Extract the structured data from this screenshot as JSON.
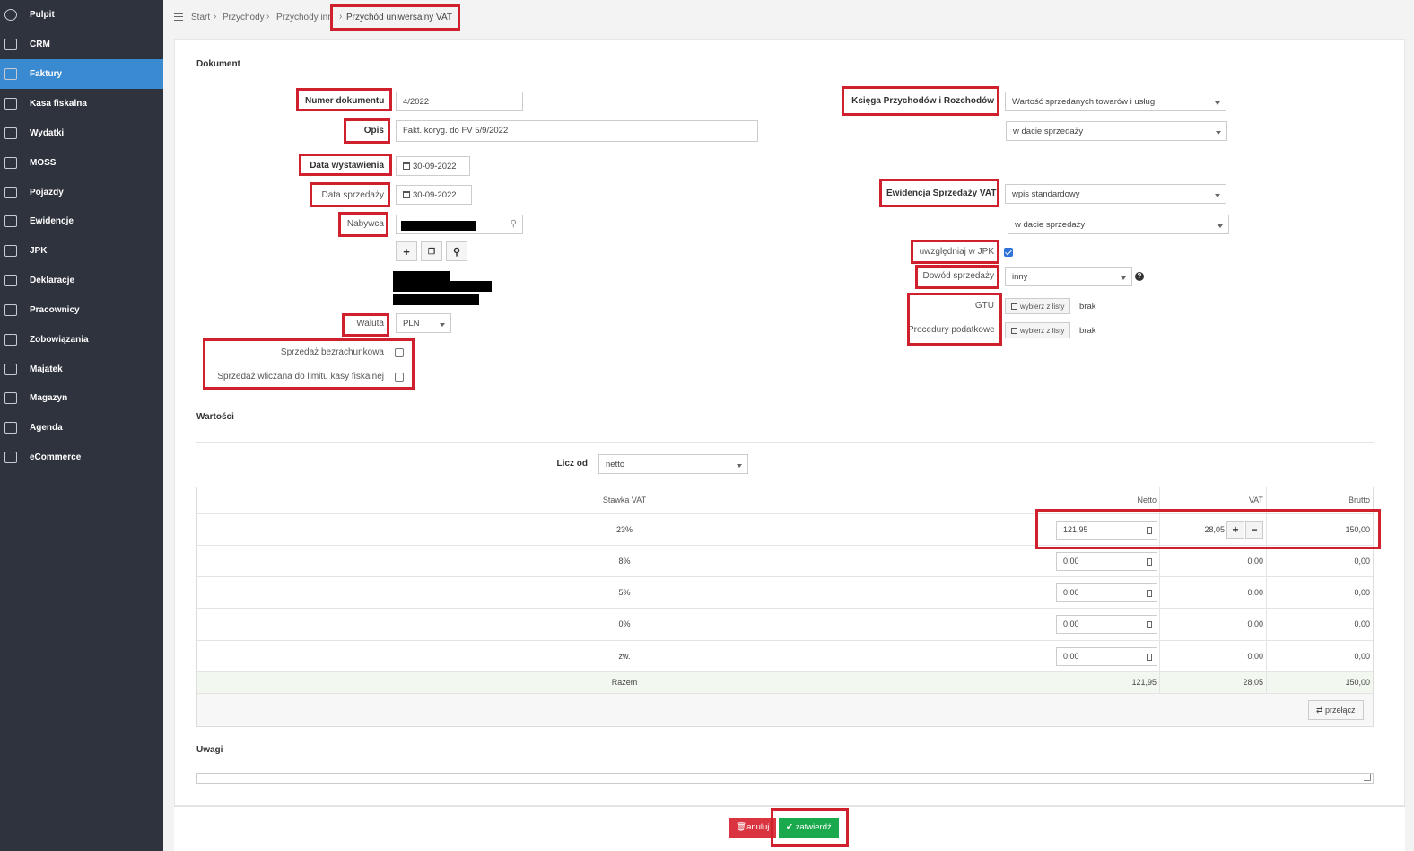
{
  "sidebar": {
    "items": [
      {
        "label": "Pulpit",
        "icon": "dashboard-icon"
      },
      {
        "label": "CRM",
        "icon": "crm-icon"
      },
      {
        "label": "Faktury",
        "icon": "invoice-icon",
        "active": true
      },
      {
        "label": "Kasa fiskalna",
        "icon": "cash-register-icon"
      },
      {
        "label": "Wydatki",
        "icon": "expenses-icon"
      },
      {
        "label": "MOSS",
        "icon": "moss-icon"
      },
      {
        "label": "Pojazdy",
        "icon": "car-icon"
      },
      {
        "label": "Ewidencje",
        "icon": "records-icon"
      },
      {
        "label": "JPK",
        "icon": "jpk-icon"
      },
      {
        "label": "Deklaracje",
        "icon": "declarations-icon"
      },
      {
        "label": "Pracownicy",
        "icon": "employees-icon"
      },
      {
        "label": "Zobowiązania",
        "icon": "liabilities-icon"
      },
      {
        "label": "Majątek",
        "icon": "assets-icon"
      },
      {
        "label": "Magazyn",
        "icon": "warehouse-icon"
      },
      {
        "label": "Agenda",
        "icon": "agenda-icon"
      },
      {
        "label": "eCommerce",
        "icon": "cart-icon"
      }
    ]
  },
  "breadcrumb": {
    "items": [
      "Start",
      "Przychody",
      "Przychody inn",
      "Przychód uniwersalny VAT"
    ]
  },
  "document": {
    "section_title": "Dokument",
    "number_label": "Numer dokumentu",
    "number_value": "4/2022",
    "description_label": "Opis",
    "description_value": "Fakt. koryg. do FV 5/9/2022",
    "issue_date_label": "Data wystawienia",
    "issue_date_value": "30-09-2022",
    "sale_date_label": "Data sprzedaży",
    "sale_date_value": "30-09-2022",
    "buyer_label": "Nabywca",
    "currency_label": "Waluta",
    "currency_value": "PLN",
    "cashless_label": "Sprzedaż bezrachunkowa",
    "fiscal_limit_label": "Sprzedaż wliczana do limitu kasy fiskalnej"
  },
  "ledger": {
    "kpir_label": "Księga Przychodów i Rozchodów",
    "kpir_value": "Wartość sprzedanych towarów i usług",
    "kpir_date_value": "w dacie sprzedaży",
    "vat_register_label": "Ewidencja Sprzedaży VAT",
    "vat_register_value": "wpis standardowy",
    "vat_date_value": "w dacie sprzedaży",
    "jpk_label": "uwzględniaj w JPK",
    "proof_label": "Dowód sprzedaży",
    "proof_value": "inny",
    "gtu_label": "GTU",
    "gtu_button": "wybierz z listy",
    "gtu_value": "brak",
    "procedures_label": "Procedury podatkowe",
    "procedures_button": "wybierz z listy",
    "procedures_value": "brak"
  },
  "values": {
    "section_title": "Wartości",
    "calc_from_label": "Licz od",
    "calc_from_value": "netto",
    "columns": [
      "Stawka VAT",
      "Netto",
      "VAT",
      "Brutto"
    ],
    "rows": [
      {
        "rate": "23%",
        "net": "121,95",
        "vat": "28,05",
        "gross": "150,00"
      },
      {
        "rate": "8%",
        "net": "0,00",
        "vat": "0,00",
        "gross": "0,00"
      },
      {
        "rate": "5%",
        "net": "0,00",
        "vat": "0,00",
        "gross": "0,00"
      },
      {
        "rate": "0%",
        "net": "0,00",
        "vat": "0,00",
        "gross": "0,00"
      },
      {
        "rate": "zw.",
        "net": "0,00",
        "vat": "0,00",
        "gross": "0,00"
      }
    ],
    "totals": {
      "label": "Razem",
      "net": "121,95",
      "vat": "28,05",
      "gross": "150,00"
    },
    "toggle_button": "przełącz"
  },
  "notes": {
    "section_title": "Uwagi"
  },
  "footer": {
    "cancel_button": "anuluj",
    "confirm_button": "zatwierdź"
  },
  "colors": {
    "sidebar": "#2f333d",
    "active": "#3a8ad2",
    "highlight": "#d0202e",
    "confirm": "#1aa94c",
    "cancel": "#d9343f"
  }
}
